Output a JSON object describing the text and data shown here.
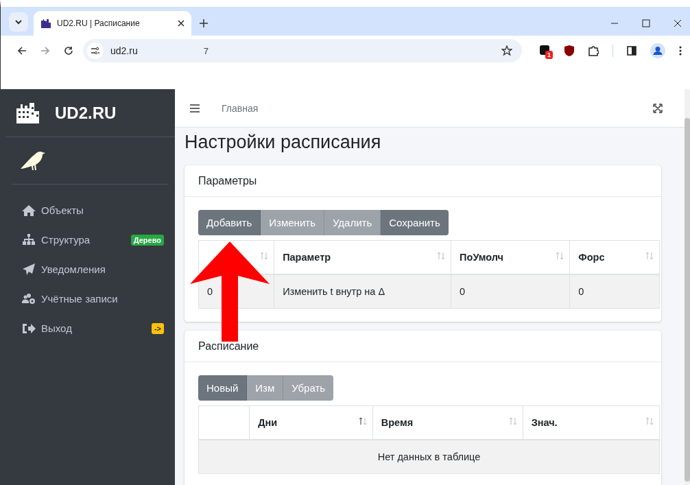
{
  "browser": {
    "tab_title": "UD2.RU | Расписание",
    "address": "ud2.ru",
    "address_extra": "7",
    "extension_badge": "1"
  },
  "sidebar": {
    "brand": "UD2.RU",
    "items": [
      {
        "label": "Объекты"
      },
      {
        "label": "Структура",
        "badge": "Дерево",
        "color": "#28a745"
      },
      {
        "label": "Уведомления"
      },
      {
        "label": "Учётные записи"
      },
      {
        "label": "Выход",
        "badge": "->",
        "color": "#ffc107"
      }
    ]
  },
  "topbar": {
    "breadcrumb": "Главная"
  },
  "page_title": "Настройки расписания",
  "cards": [
    {
      "title": "Параметры",
      "buttons": [
        {
          "label": "Добавить",
          "disabled": false
        },
        {
          "label": "Изменить",
          "disabled": true
        },
        {
          "label": "Удалить",
          "disabled": true
        },
        {
          "label": "Сохранить",
          "disabled": false
        }
      ],
      "columns": [
        {
          "sorted": false
        },
        {
          "label": "Параметр",
          "sorted": false
        },
        {
          "label": "ПоУмолч",
          "sorted": false
        },
        {
          "label": "Форс",
          "sorted": false
        }
      ],
      "rows": [
        [
          "0",
          "Изменить t внутр на Δ",
          "0",
          "0"
        ]
      ]
    },
    {
      "title": "Расписание",
      "buttons": [
        {
          "label": "Новый",
          "disabled": false
        },
        {
          "label": "Изм",
          "disabled": true
        },
        {
          "label": "Убрать",
          "disabled": true
        }
      ],
      "columns": [
        {},
        {
          "label": "Дни",
          "sorted": true
        },
        {
          "label": "Время",
          "sorted": false
        },
        {
          "label": "Знач.",
          "sorted": false
        }
      ],
      "empty_text": "Нет данных в таблице"
    }
  ]
}
